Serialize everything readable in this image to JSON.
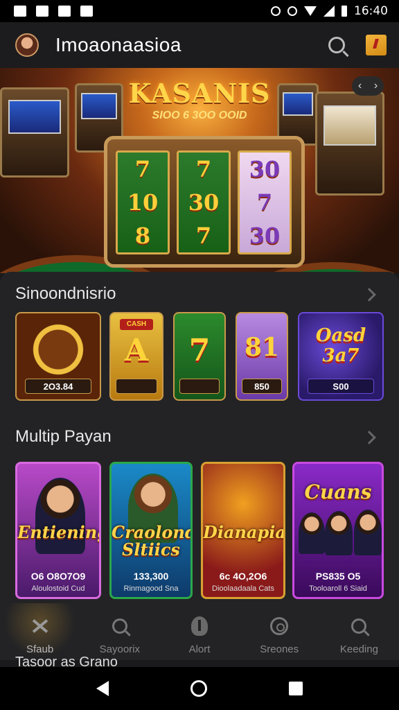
{
  "status": {
    "time": "16:40"
  },
  "header": {
    "title": "Imoaonaasioa"
  },
  "hero": {
    "logo": "KASANIS",
    "subtitle": "SIOO 6 3OO OOID",
    "reels": [
      [
        "7",
        "10",
        "8"
      ],
      [
        "7",
        "30",
        "7"
      ],
      [
        "30",
        "7",
        "30"
      ]
    ]
  },
  "section1": {
    "title": "Sinoondnisrio",
    "items": [
      {
        "caption": "2O3.84",
        "theme": "roulette"
      },
      {
        "caption": "",
        "glyph": "A",
        "tag": "CASH",
        "theme": "gold"
      },
      {
        "caption": "",
        "glyph": "7",
        "theme": "green"
      },
      {
        "caption": "850",
        "glyph": "81",
        "theme": "purple"
      },
      {
        "caption": "S00",
        "glyph": "Oasd 3a7",
        "theme": "blue"
      }
    ]
  },
  "section2": {
    "title": "Multip Payan",
    "cards": [
      {
        "label": "Entiening",
        "number": "O6 O8O7O9",
        "foot": "Aloulostoid Cud"
      },
      {
        "label": "Craolond Sltiics",
        "number": "133,300",
        "foot": "Rinmagood Sna"
      },
      {
        "label": "Dianapias",
        "number": "6c 4O,2O6",
        "foot": "Dioolaadaala Cats"
      },
      {
        "label": "Cuans",
        "number": "PS835 O5",
        "foot": "Tooloaroll 6 Siaid"
      }
    ]
  },
  "nav": {
    "items": [
      {
        "label": "Sfaub",
        "icon": "crossed-icon",
        "active": true
      },
      {
        "label": "Sayoorix",
        "icon": "search-icon",
        "active": false
      },
      {
        "label": "Alort",
        "icon": "alert-icon",
        "active": false
      },
      {
        "label": "Sreones",
        "icon": "ring-icon",
        "active": false
      },
      {
        "label": "Keeding",
        "icon": "search-icon",
        "active": false
      }
    ]
  },
  "peek": {
    "text": "Tasoor as Grano"
  }
}
